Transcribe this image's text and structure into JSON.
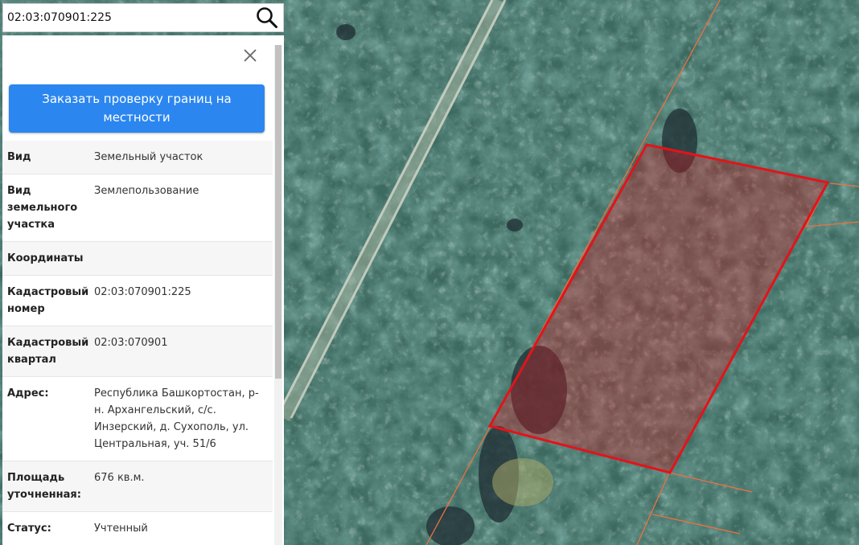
{
  "search": {
    "value": "02:03:070901:225",
    "icon": "search-icon"
  },
  "panel": {
    "close_icon": "close-icon",
    "order_button_label": "Заказать проверку границ на местности",
    "rows": [
      {
        "label": "Вид",
        "value": "Земельный участок"
      },
      {
        "label": "Вид земельного участка",
        "value": "Землепользование"
      },
      {
        "label": "Координаты",
        "value": ""
      },
      {
        "label": "Кадастровый номер",
        "value": "02:03:070901:225"
      },
      {
        "label": "Кадастровый квартал",
        "value": "02:03:070901"
      },
      {
        "label": "Адрес:",
        "value": "Республика Башкортостан, р-н. Архангельский, с/с. Инзерский, д. Сухополь, ул. Центральная, уч. 51/6"
      },
      {
        "label": "Площадь уточненная:",
        "value": "676 кв.м."
      },
      {
        "label": "Статус:",
        "value": "Учтенный"
      }
    ]
  },
  "map": {
    "type": "satellite",
    "highlight_color": "#e3131a",
    "boundary_color": "#f07040",
    "button_color": "#2b86f0"
  }
}
